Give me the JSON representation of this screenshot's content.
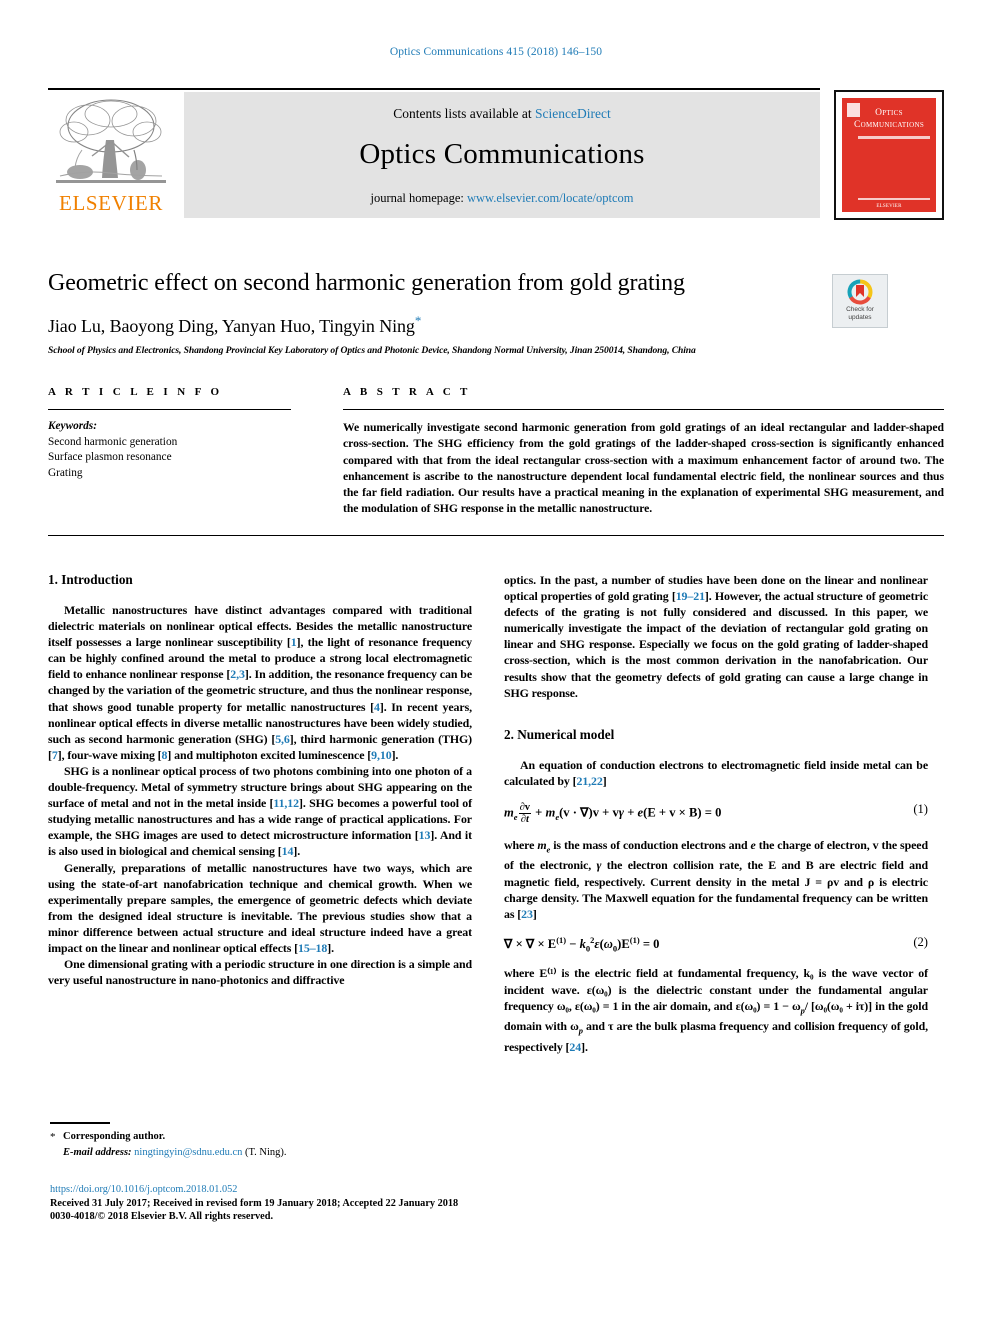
{
  "running_head": "Optics Communications 415 (2018) 146–150",
  "masthead": {
    "publisher_wordmark": "ELSEVIER",
    "contents_prefix": "Contents lists available at",
    "contents_link": "ScienceDirect",
    "journal_title": "Optics Communications",
    "homepage_prefix": "journal homepage:",
    "homepage_link": "www.elsevier.com/locate/optcom",
    "cover": {
      "line1": "Optics",
      "line2": "Communications",
      "foot": "ELSEVIER"
    }
  },
  "article": {
    "title": "Geometric effect on second harmonic generation from gold grating",
    "authors": "Jiao Lu, Baoyong Ding, Yanyan Huo, Tingyin Ning",
    "corresponding_marker": "*",
    "affiliation": "School of Physics and Electronics, Shandong Provincial Key Laboratory of Optics and Photonic Device, Shandong Normal University, Jinan 250014, Shandong, China",
    "crossmark_label_line1": "Check for",
    "crossmark_label_line2": "updates"
  },
  "info": {
    "heading": "A R T I C L E    I N F O",
    "keywords_title": "Keywords:",
    "keywords": [
      "Second harmonic generation",
      "Surface plasmon resonance",
      "Grating"
    ]
  },
  "abstract": {
    "heading": "A B S T R A C T",
    "text": "We numerically investigate second harmonic generation from gold gratings of an ideal rectangular and ladder-shaped cross-section. The SHG efficiency from the gold gratings of the ladder-shaped cross-section is significantly enhanced compared with that from the ideal rectangular cross-section with a maximum enhancement factor of around two. The enhancement is ascribe to the nanostructure dependent local fundamental electric field, the nonlinear sources and thus the far field radiation. Our results have a practical meaning in the explanation of experimental SHG measurement, and the modulation of SHG response in the metallic nanostructure."
  },
  "sections": {
    "introduction_heading": "1. Introduction",
    "numerical_heading": "2. Numerical model"
  },
  "left_column": {
    "p1_a": "Metallic nanostructures have distinct advantages  compared with traditional dielectric materials on nonlinear optical effects. Besides the metallic nanostructure itself possesses a large nonlinear susceptibility [",
    "p1_r1": "1",
    "p1_b": "], the light of resonance frequency can be highly confined around the metal to produce a strong local electromagnetic field to enhance nonlinear response [",
    "p1_r2": "2,3",
    "p1_c": "]. In addition, the resonance frequency can be changed by the variation of the geometric structure, and thus the nonlinear response, that shows good tunable property for metallic nanostructures [",
    "p1_r3": "4",
    "p1_d": "]. In recent years, nonlinear optical effects in diverse metallic nanostructures have been widely studied, such as second harmonic generation (SHG) [",
    "p1_r4": "5,6",
    "p1_e": "], third harmonic generation (THG) [",
    "p1_r5": "7",
    "p1_f": "], four-wave mixing [",
    "p1_r6": "8",
    "p1_g": "] and multiphoton excited luminescence [",
    "p1_r7": "9,10",
    "p1_h": "].",
    "p2_a": "SHG is a nonlinear optical process of two photons combining into one photon of a double-frequency. Metal of symmetry structure brings about SHG appearing on the surface of metal and not in the metal inside [",
    "p2_r1": "11,12",
    "p2_b": "]. SHG becomes a powerful tool of studying metallic nanostructures and has a wide range of practical applications. For example, the SHG images are used to detect microstructure information [",
    "p2_r2": "13",
    "p2_c": "]. And it is also used in biological and chemical sensing [",
    "p2_r3": "14",
    "p2_d": "].",
    "p3_a": "Generally, preparations of metallic nanostructures have two ways, which are using the state-of-art nanofabrication technique and chemical growth. When we experimentally prepare samples, the emergence of geometric defects which deviate from the designed ideal structure is inevitable. The previous studies show that a minor difference between actual structure and ideal structure indeed have a great impact on the linear and nonlinear optical effects [",
    "p3_r1": "15–18",
    "p3_b": "].",
    "p4": "One dimensional grating with a periodic structure in one direction is a simple and very useful nanostructure in nano-photonics and diffractive"
  },
  "right_column": {
    "p1_a": "optics. In the past, a number of studies have been done on the linear and nonlinear optical properties of gold grating [",
    "p1_r1": "19–21",
    "p1_b": "]. However, the actual structure of geometric defects of the grating is not fully considered and discussed. In this paper, we numerically investigate the impact of the deviation of rectangular gold grating on linear and SHG response. Especially we focus on the gold grating of ladder-shaped cross-section, which is the most common derivation in the nanofabrication. Our results show that the geometry defects of gold grating can cause a large change in SHG response.",
    "p2_a": "An equation of conduction electrons to electromagnetic field inside metal can be calculated by [",
    "p2_r1": "21,22",
    "p2_b": "]",
    "eq1_number": "(1)",
    "p3_a": "where ",
    "p3_b": " is the mass of conduction electrons and ",
    "p3_c": " the charge of electron, ",
    "p3_d": " the speed of the electronic, ",
    "p3_e": " the electron collision rate, the E and B are electric field and magnetic field, respectively. Current density in the metal J = ρv and ρ is electric charge density. The Maxwell equation for the fundamental frequency can be written as [",
    "p3_r1": "23",
    "p3_f": "]",
    "eq2_number": "(2)",
    "p4_text": "where E⁽¹⁾ is the electric field at fundamental frequency, k₀ is the wave vector of incident wave. ε(ω₀) is the dielectric constant under the fundamental angular frequency ω₀, ε(ω₀) = 1 in the air domain, and ε(ω₀) = 1 − ω",
    "p4_text2": "/ [ω₀(ω₀ + iτ)] in the gold domain with ω",
    "p4_text3": " and τ are the bulk plasma frequency and collision frequency of gold, respectively [",
    "p4_r1": "24",
    "p4_b": "]."
  },
  "footer": {
    "corresponding_author": "Corresponding author.",
    "email_label": "E-mail address:",
    "email": "ningtingyin@sdnu.edu.cn",
    "email_suffix": "(T. Ning).",
    "doi": "https://doi.org/10.1016/j.optcom.2018.01.052",
    "received": "Received 31 July 2017; Received in revised form 19 January 2018; Accepted 22 January 2018",
    "copyright": "0030-4018/© 2018 Elsevier B.V. All rights reserved."
  },
  "colors": {
    "link_blue": "#1f7bb6",
    "elsevier_orange": "#f08000",
    "cover_red": "#e03328",
    "banner_gray": "#e3e3e3"
  }
}
